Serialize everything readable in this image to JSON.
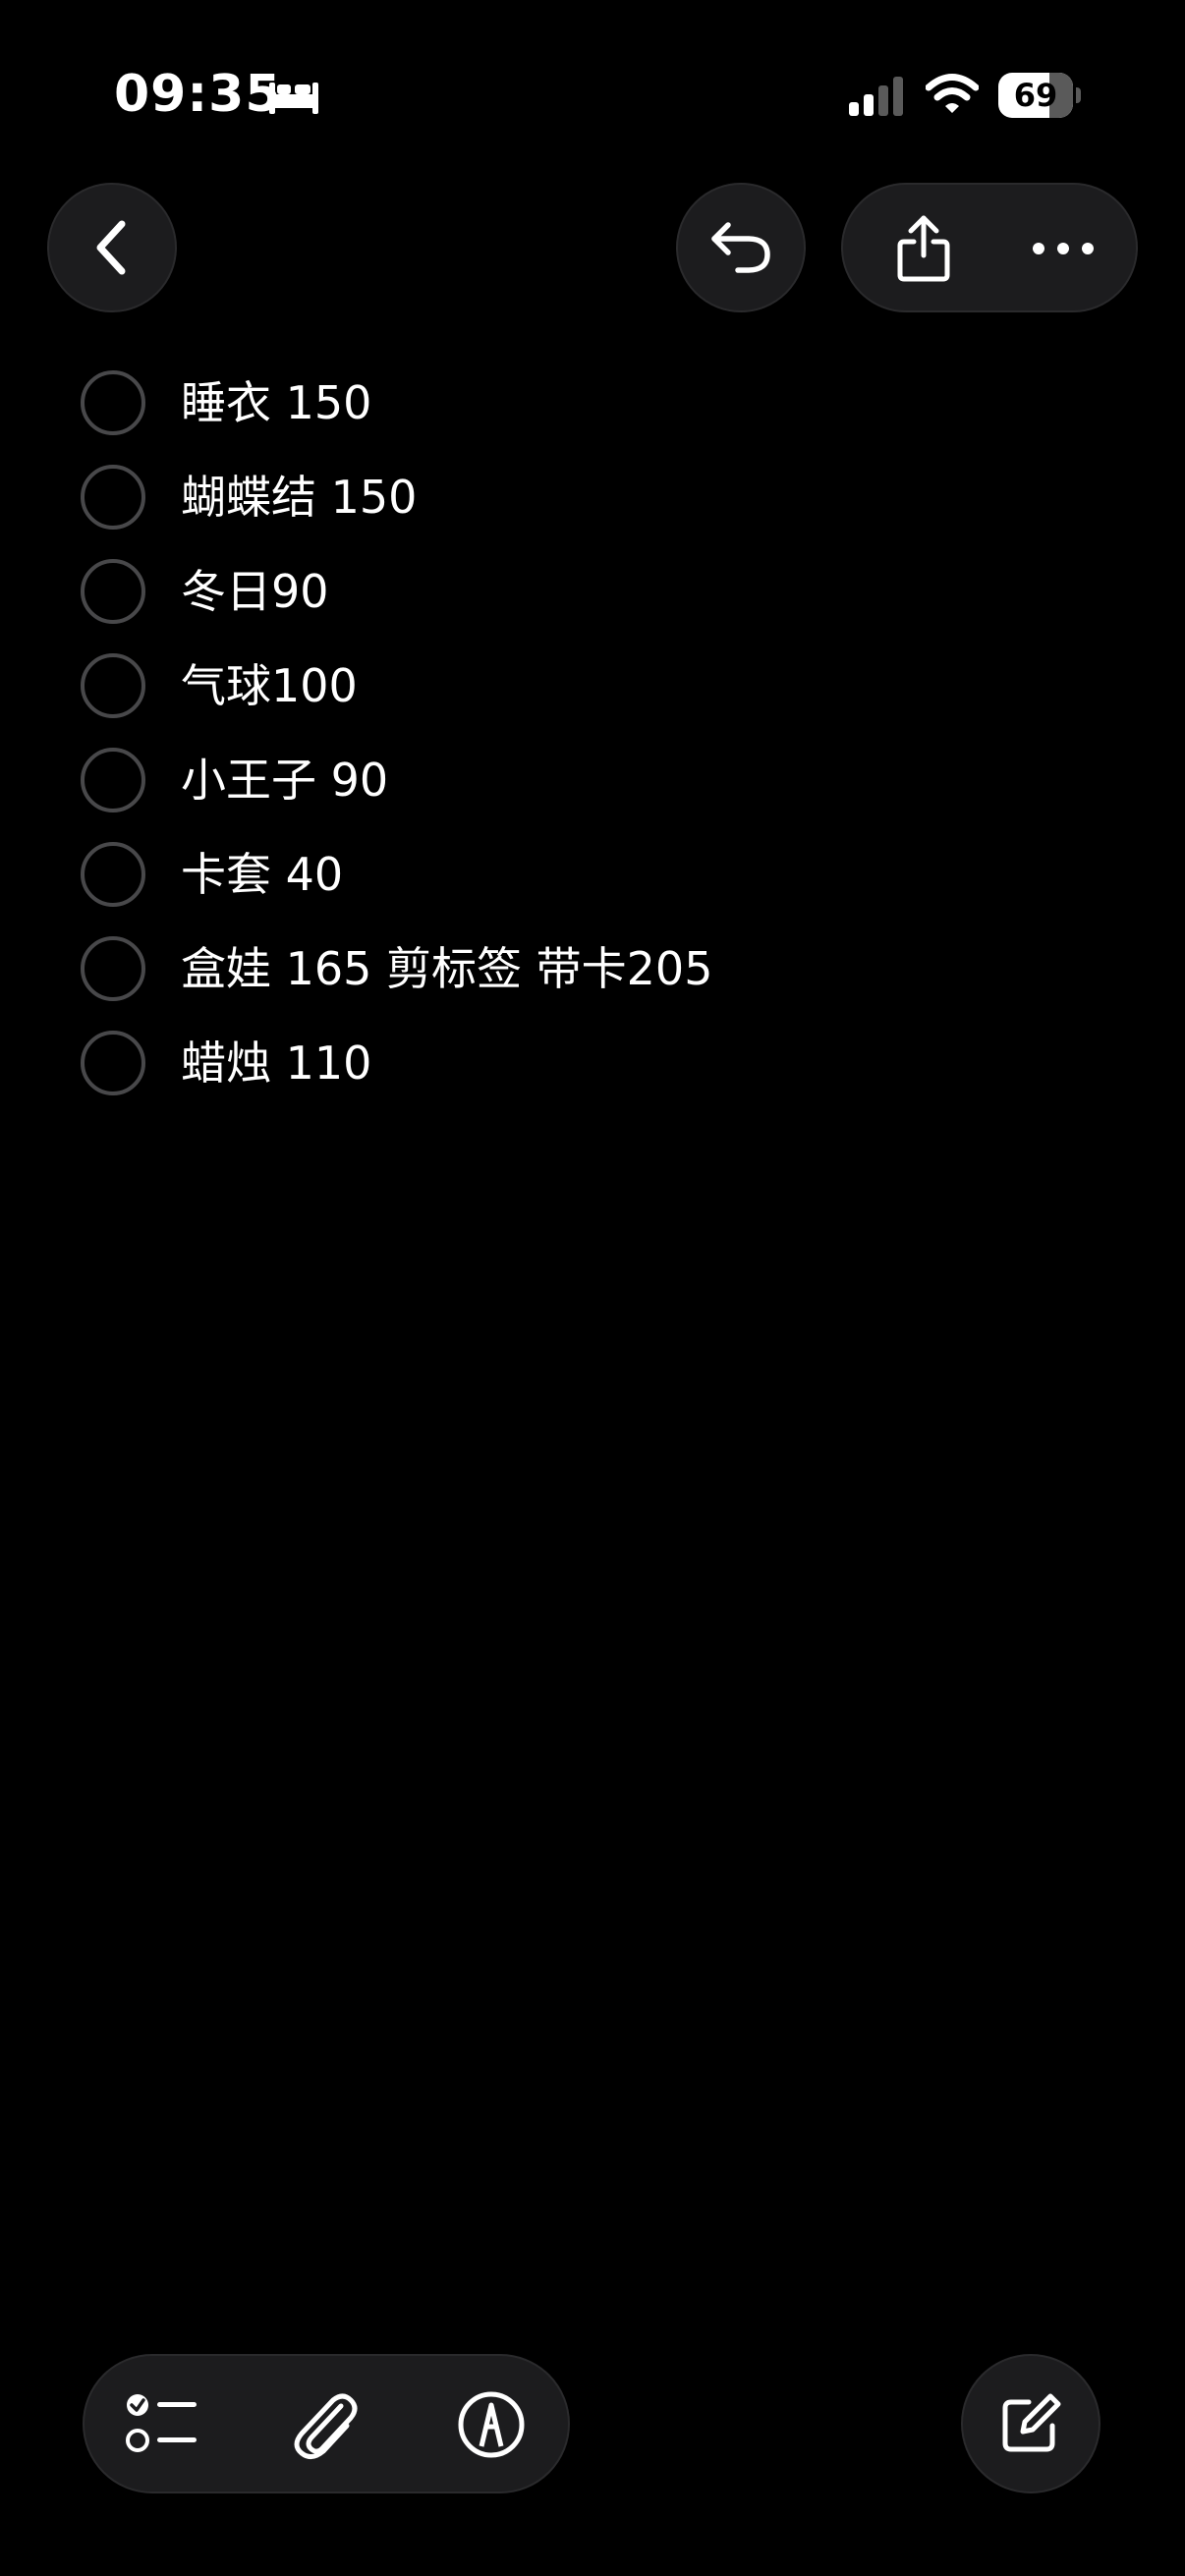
{
  "status_bar": {
    "time": "09:35",
    "battery": "69",
    "sleep_icon": "bed-icon",
    "signal_icon": "cellular-signal-icon",
    "wifi_icon": "wifi-icon"
  },
  "nav": {
    "back_icon": "chevron-left-icon",
    "undo_icon": "undo-icon",
    "share_icon": "share-icon",
    "more_icon": "ellipsis-icon"
  },
  "checklist": [
    {
      "text": "睡衣 150",
      "checked": false
    },
    {
      "text": "蝴蝶结 150",
      "checked": false
    },
    {
      "text": "冬日90",
      "checked": false
    },
    {
      "text": "气球100",
      "checked": false
    },
    {
      "text": "小王子 90",
      "checked": false
    },
    {
      "text": "卡套 40",
      "checked": false
    },
    {
      "text": "盒娃 165 剪标签 带卡205",
      "checked": false
    },
    {
      "text": "蜡烛 110",
      "checked": false
    }
  ],
  "toolbar": {
    "checklist_icon": "checklist-icon",
    "attachment_icon": "paperclip-icon",
    "markup_icon": "markup-pen-icon",
    "compose_icon": "compose-icon"
  },
  "colors": {
    "background": "#000000",
    "button_fill": "#1c1c1e",
    "circle_border": "#48484a",
    "text": "#ffffff"
  }
}
